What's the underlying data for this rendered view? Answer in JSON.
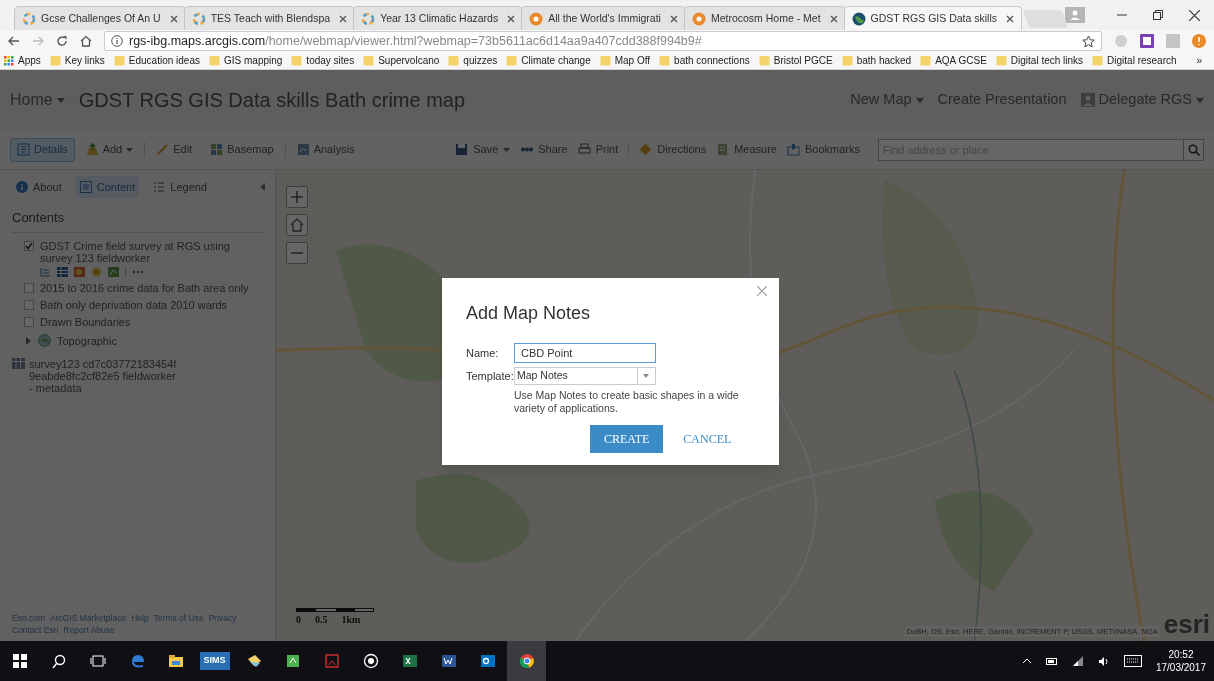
{
  "browser": {
    "tabs": [
      {
        "title": "Gcse Challenges Of An U",
        "selected": false,
        "kind": "ring"
      },
      {
        "title": "TES Teach with Blendspa",
        "selected": false,
        "kind": "ring"
      },
      {
        "title": "Year 13 Climatic Hazards",
        "selected": false,
        "kind": "ring"
      },
      {
        "title": "All the World's Immigrati",
        "selected": false,
        "kind": "circle"
      },
      {
        "title": "Metrocosm Home - Met",
        "selected": false,
        "kind": "circle"
      },
      {
        "title": "GDST RGS GIS Data skills",
        "selected": true,
        "kind": "globe"
      }
    ],
    "address": {
      "host": "rgs-ibg.maps.arcgis.com",
      "path": "/home/webmap/viewer.html?webmap=73b5611ac6d14aa9a407cdd388f994b9#"
    },
    "apps_label": "Apps",
    "bookmarks": [
      "Key links",
      "Education ideas",
      "GIS mapping",
      "today sites",
      "Supervolcano",
      "quizzes",
      "Climate change",
      "Map Off",
      "bath connections",
      "Bristol PGCE",
      "bath hacked",
      "AQA GCSE",
      "Digital tech links",
      "Digital research"
    ],
    "bookmarks_more": "»"
  },
  "header": {
    "home": "Home",
    "title": "GDST RGS GIS Data skills Bath crime map",
    "links": [
      "New Map",
      "Create Presentation"
    ],
    "user": "Delegate RGS"
  },
  "toolbar": {
    "left": [
      {
        "label": "Details",
        "selected": true,
        "dropdown": false
      },
      {
        "label": "Add",
        "selected": false,
        "dropdown": true
      },
      {
        "label": "Edit",
        "selected": false,
        "dropdown": false
      },
      {
        "label": "Basemap",
        "selected": false,
        "dropdown": false
      },
      {
        "label": "Analysis",
        "selected": false,
        "dropdown": false
      }
    ],
    "right": [
      {
        "label": "Save",
        "dropdown": true
      },
      {
        "label": "Share",
        "dropdown": false
      },
      {
        "label": "Print",
        "dropdown": false
      },
      {
        "label": "Directions",
        "dropdown": false
      },
      {
        "label": "Measure",
        "dropdown": false
      },
      {
        "label": "Bookmarks",
        "dropdown": false
      }
    ],
    "search": {
      "placeholder": "Find address or place"
    }
  },
  "panel": {
    "tabs": [
      {
        "label": "About",
        "selected": false
      },
      {
        "label": "Content",
        "selected": true
      },
      {
        "label": "Legend",
        "selected": false
      }
    ],
    "heading": "Contents",
    "layers": [
      {
        "kind": "layer",
        "label": "GDST Crime field survey at RGS using survey 123 fieldworker",
        "checked": true,
        "tools": true
      },
      {
        "kind": "layer",
        "label": "2015 to 2016 crime data for Bath area only",
        "checked": false,
        "tools": false
      },
      {
        "kind": "layer",
        "label": "Bath only deprivation data 2010 wards",
        "checked": false,
        "tools": false
      },
      {
        "kind": "layer",
        "label": "Drawn Boundaries",
        "checked": false,
        "tools": false
      },
      {
        "kind": "basemap",
        "label": "Topographic",
        "expanded": false
      },
      {
        "kind": "table",
        "label": "survey123 cd7c03772183454f9eabde8fc2cf82e5 fieldworker - metadata"
      }
    ],
    "footer": [
      [
        "Esri.com",
        "ArcGIS Marketplace",
        "Help",
        "Terms of Use",
        "Privacy"
      ],
      [
        "Contact Esri",
        "Report Abuse"
      ]
    ]
  },
  "map": {
    "scale": [
      "0",
      "0.5",
      "1km"
    ],
    "attribution": "DoBH, OS, Esri, HERE, Garmin, INCREMENT P, USGS, METI/NASA, NGA",
    "logo": "esri"
  },
  "dialog": {
    "title": "Add Map Notes",
    "name_label": "Name:",
    "name_value": "CBD Point",
    "template_label": "Template:",
    "template_value": "Map Notes",
    "description": "Use Map Notes to create basic shapes in a wide variety of applications.",
    "create": "CREATE",
    "cancel": "CANCEL"
  },
  "taskbar": {
    "sims": "SIMS",
    "time": "20:52",
    "date": "17/03/2017"
  }
}
